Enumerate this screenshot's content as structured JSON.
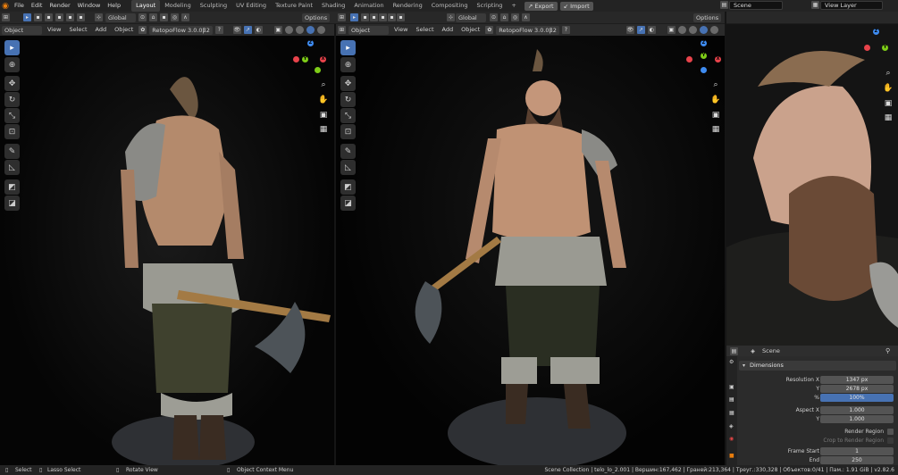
{
  "topbar": {
    "menu": [
      "File",
      "Edit",
      "Render",
      "Window",
      "Help"
    ],
    "workspaces": [
      "Layout",
      "Modeling",
      "Sculpting",
      "UV Editing",
      "Texture Paint",
      "Shading",
      "Animation",
      "Rendering",
      "Compositing",
      "Scripting"
    ],
    "plus": "+",
    "export": "Export",
    "import": "Import",
    "scene": "Scene",
    "view_layer": "View Layer"
  },
  "toolheader": {
    "transform": "Global",
    "options": "Options"
  },
  "left_view": {
    "mode": "Object Mode",
    "menus": [
      "View",
      "Select",
      "Add",
      "Object"
    ],
    "addon": "RetopoFlow 3.0.0β2"
  },
  "right_view": {
    "mode": "Object Mode",
    "menus": [
      "View",
      "Select",
      "Add",
      "Object"
    ],
    "addon": "RetopoFlow 3.0.0β2"
  },
  "properties": {
    "scene": "Scene",
    "panel": "Dimensions",
    "res_x_label": "Resolution X",
    "res_x": "1347 px",
    "res_y_label": "Y",
    "res_y": "2678 px",
    "pct_label": "%",
    "pct": "100%",
    "aspect_x_label": "Aspect X",
    "aspect_x": "1.000",
    "aspect_y_label": "Y",
    "aspect_y": "1.000",
    "render_region": "Render Region",
    "crop": "Crop to Render Region",
    "frame_start_label": "Frame Start",
    "frame_start": "1",
    "end_label": "End",
    "end": "250"
  },
  "status": {
    "select": "Select",
    "lasso": "Lasso Select",
    "rotate": "Rotate View",
    "context": "Object Context Menu",
    "info": "Scene Collection | telo_lo_2.001 | Вершин:167,462 | Граней:213,364 | Треуг.:330,328 | Объектов:0/41 | Пам.: 1.91 GiB | v2.82.6"
  },
  "colors": {
    "accent": "#4772b3",
    "logo": "#e87d0d",
    "x_axis": "#e8434b",
    "y_axis": "#7ecc18",
    "z_axis": "#3e8bf0"
  }
}
